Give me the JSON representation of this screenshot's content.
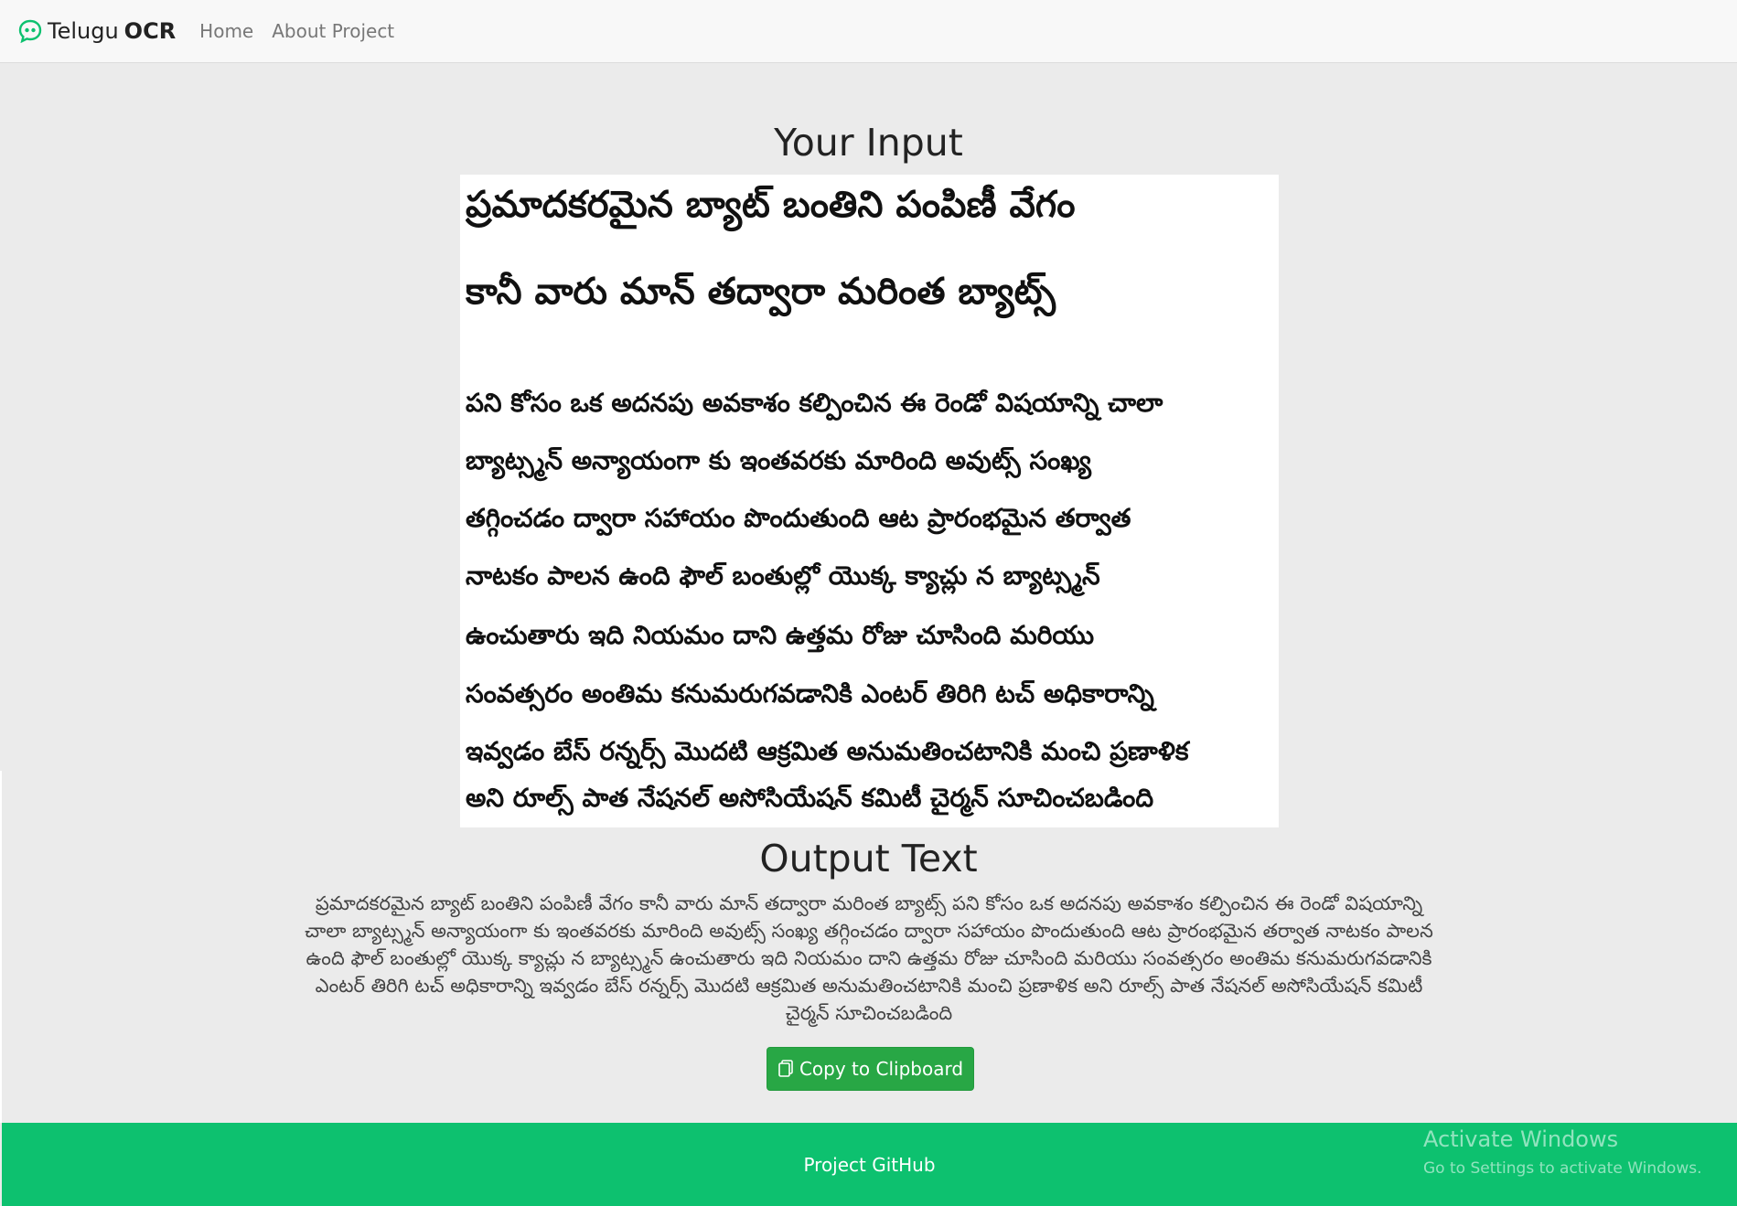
{
  "navbar": {
    "brand_name": "Telugu",
    "brand_bold": "OCR",
    "links": [
      "Home",
      "About Project"
    ],
    "accent_color": "#0dc16f"
  },
  "input_section": {
    "title": "Your Input",
    "image_lines": [
      "ప్రమాదకరమైన బ్యాట్ బంతిని పంపిణీ వేగం",
      "కానీ వారు మాన్ తద్వారా మరింత బ్యాట్స్",
      "పని కోసం ఒక అదనపు అవకాశం కల్పించిన ఈ రెండో విషయాన్ని చాలా",
      "బ్యాట్స్మన్ అన్యాయంగా కు ఇంతవరకు మారింది అవుట్స్ సంఖ్య",
      "తగ్గించడం ద్వారా సహాయం పొందుతుంది ఆట ప్రారంభమైన తర్వాత",
      "నాటకం పాలన ఉంది ఫౌల్ బంతుల్లో యొక్క క్యాచ్లు న బ్యాట్స్మన్",
      "ఉంచుతారు ఇది నియమం దాని ఉత్తమ రోజు చూసింది మరియు",
      "సంవత్సరం అంతిమ కనుమరుగవడానికి ఎంటర్ తిరిగి టచ్ అధికారాన్ని",
      "ఇవ్వడం బేస్ రన్నర్స్ మొదటి ఆక్రమిత అనుమతించటానికి మంచి ప్రణాళిక",
      "అని రూల్స్ పాత నేషనల్ అసోసియేషన్ కమిటీ చైర్మన్ సూచించబడింది"
    ]
  },
  "output_section": {
    "title": "Output Text",
    "text": "ప్రమాదకరమైన బ్యాట్ బంతిని పంపిణీ వేగం కానీ వారు మాన్ తద్వారా మరింత బ్యాట్స్ పని కోసం ఒక అదనపు అవకాశం కల్పించిన ఈ రెండో విషయాన్ని చాలా బ్యాట్స్మన్ అన్యాయంగా కు ఇంతవరకు మారింది అవుట్స్ సంఖ్య తగ్గించడం ద్వారా సహాయం పొందుతుంది ఆట ప్రారంభమైన తర్వాత నాటకం పాలన ఉంది ఫౌల్ బంతుల్లో యొక్క క్యాచ్లు న బ్యాట్స్మన్ ఉంచుతారు ఇది నియమం దాని ఉత్తమ రోజు చూసింది మరియు సంవత్సరం అంతిమ కనుమరుగవడానికి ఎంటర్ తిరిగి టచ్ అధికారాన్ని ఇవ్వడం బేస్ రన్నర్స్ మొదటి ఆక్రమిత అనుమతించటానికి మంచి ప్రణాళిక అని రూల్స్ పాత నేషనల్ అసోసియేషన్ కమిటీ చైర్మన్ సూచించబడింది",
    "copy_button_label": "Copy to Clipboard",
    "button_color": "#28a745"
  },
  "footer": {
    "link_label": "Project GitHub",
    "background_color": "#0dc16f"
  },
  "watermark": {
    "line1": "Activate Windows",
    "line2": "Go to Settings to activate Windows."
  }
}
